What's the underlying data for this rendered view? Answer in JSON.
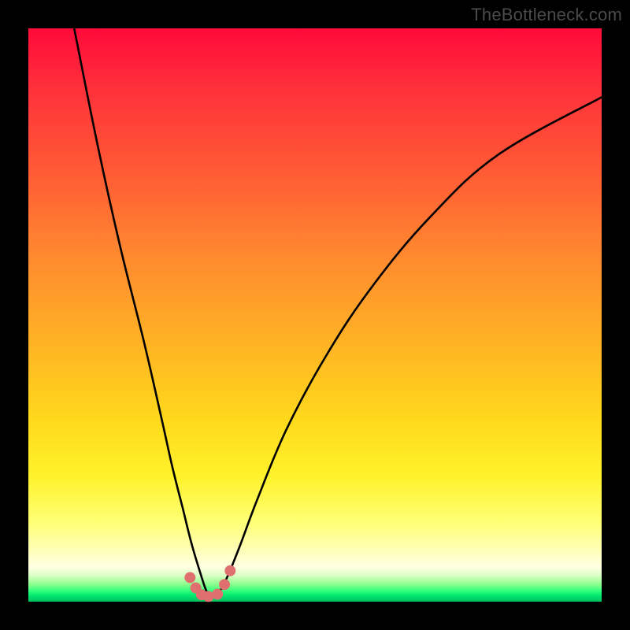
{
  "watermark": "TheBottleneck.com",
  "chart_data": {
    "type": "line",
    "title": "",
    "xlabel": "",
    "ylabel": "",
    "xlim": [
      0,
      100
    ],
    "ylim": [
      0,
      100
    ],
    "series": [
      {
        "name": "curve",
        "x": [
          8,
          12,
          16,
          20,
          23,
          25,
          27,
          28.5,
          30,
          31,
          32,
          33.5,
          35,
          37,
          40,
          45,
          52,
          60,
          70,
          82,
          100
        ],
        "y": [
          100,
          80,
          62,
          46,
          33,
          24,
          16,
          10,
          5,
          2,
          0.7,
          2,
          5,
          10,
          18,
          30,
          43,
          55,
          67,
          78,
          88
        ]
      }
    ],
    "markers": {
      "name": "dots",
      "color": "#e07070",
      "x": [
        28.2,
        29.2,
        30.2,
        31.4,
        33.0,
        34.2,
        35.2
      ],
      "y": [
        4.2,
        2.4,
        1.2,
        0.9,
        1.3,
        3.0,
        5.4
      ]
    },
    "background": {
      "gradient_top": "#ff0a3a",
      "gradient_mid": "#ffd81c",
      "gradient_bottom": "#00c060"
    }
  }
}
